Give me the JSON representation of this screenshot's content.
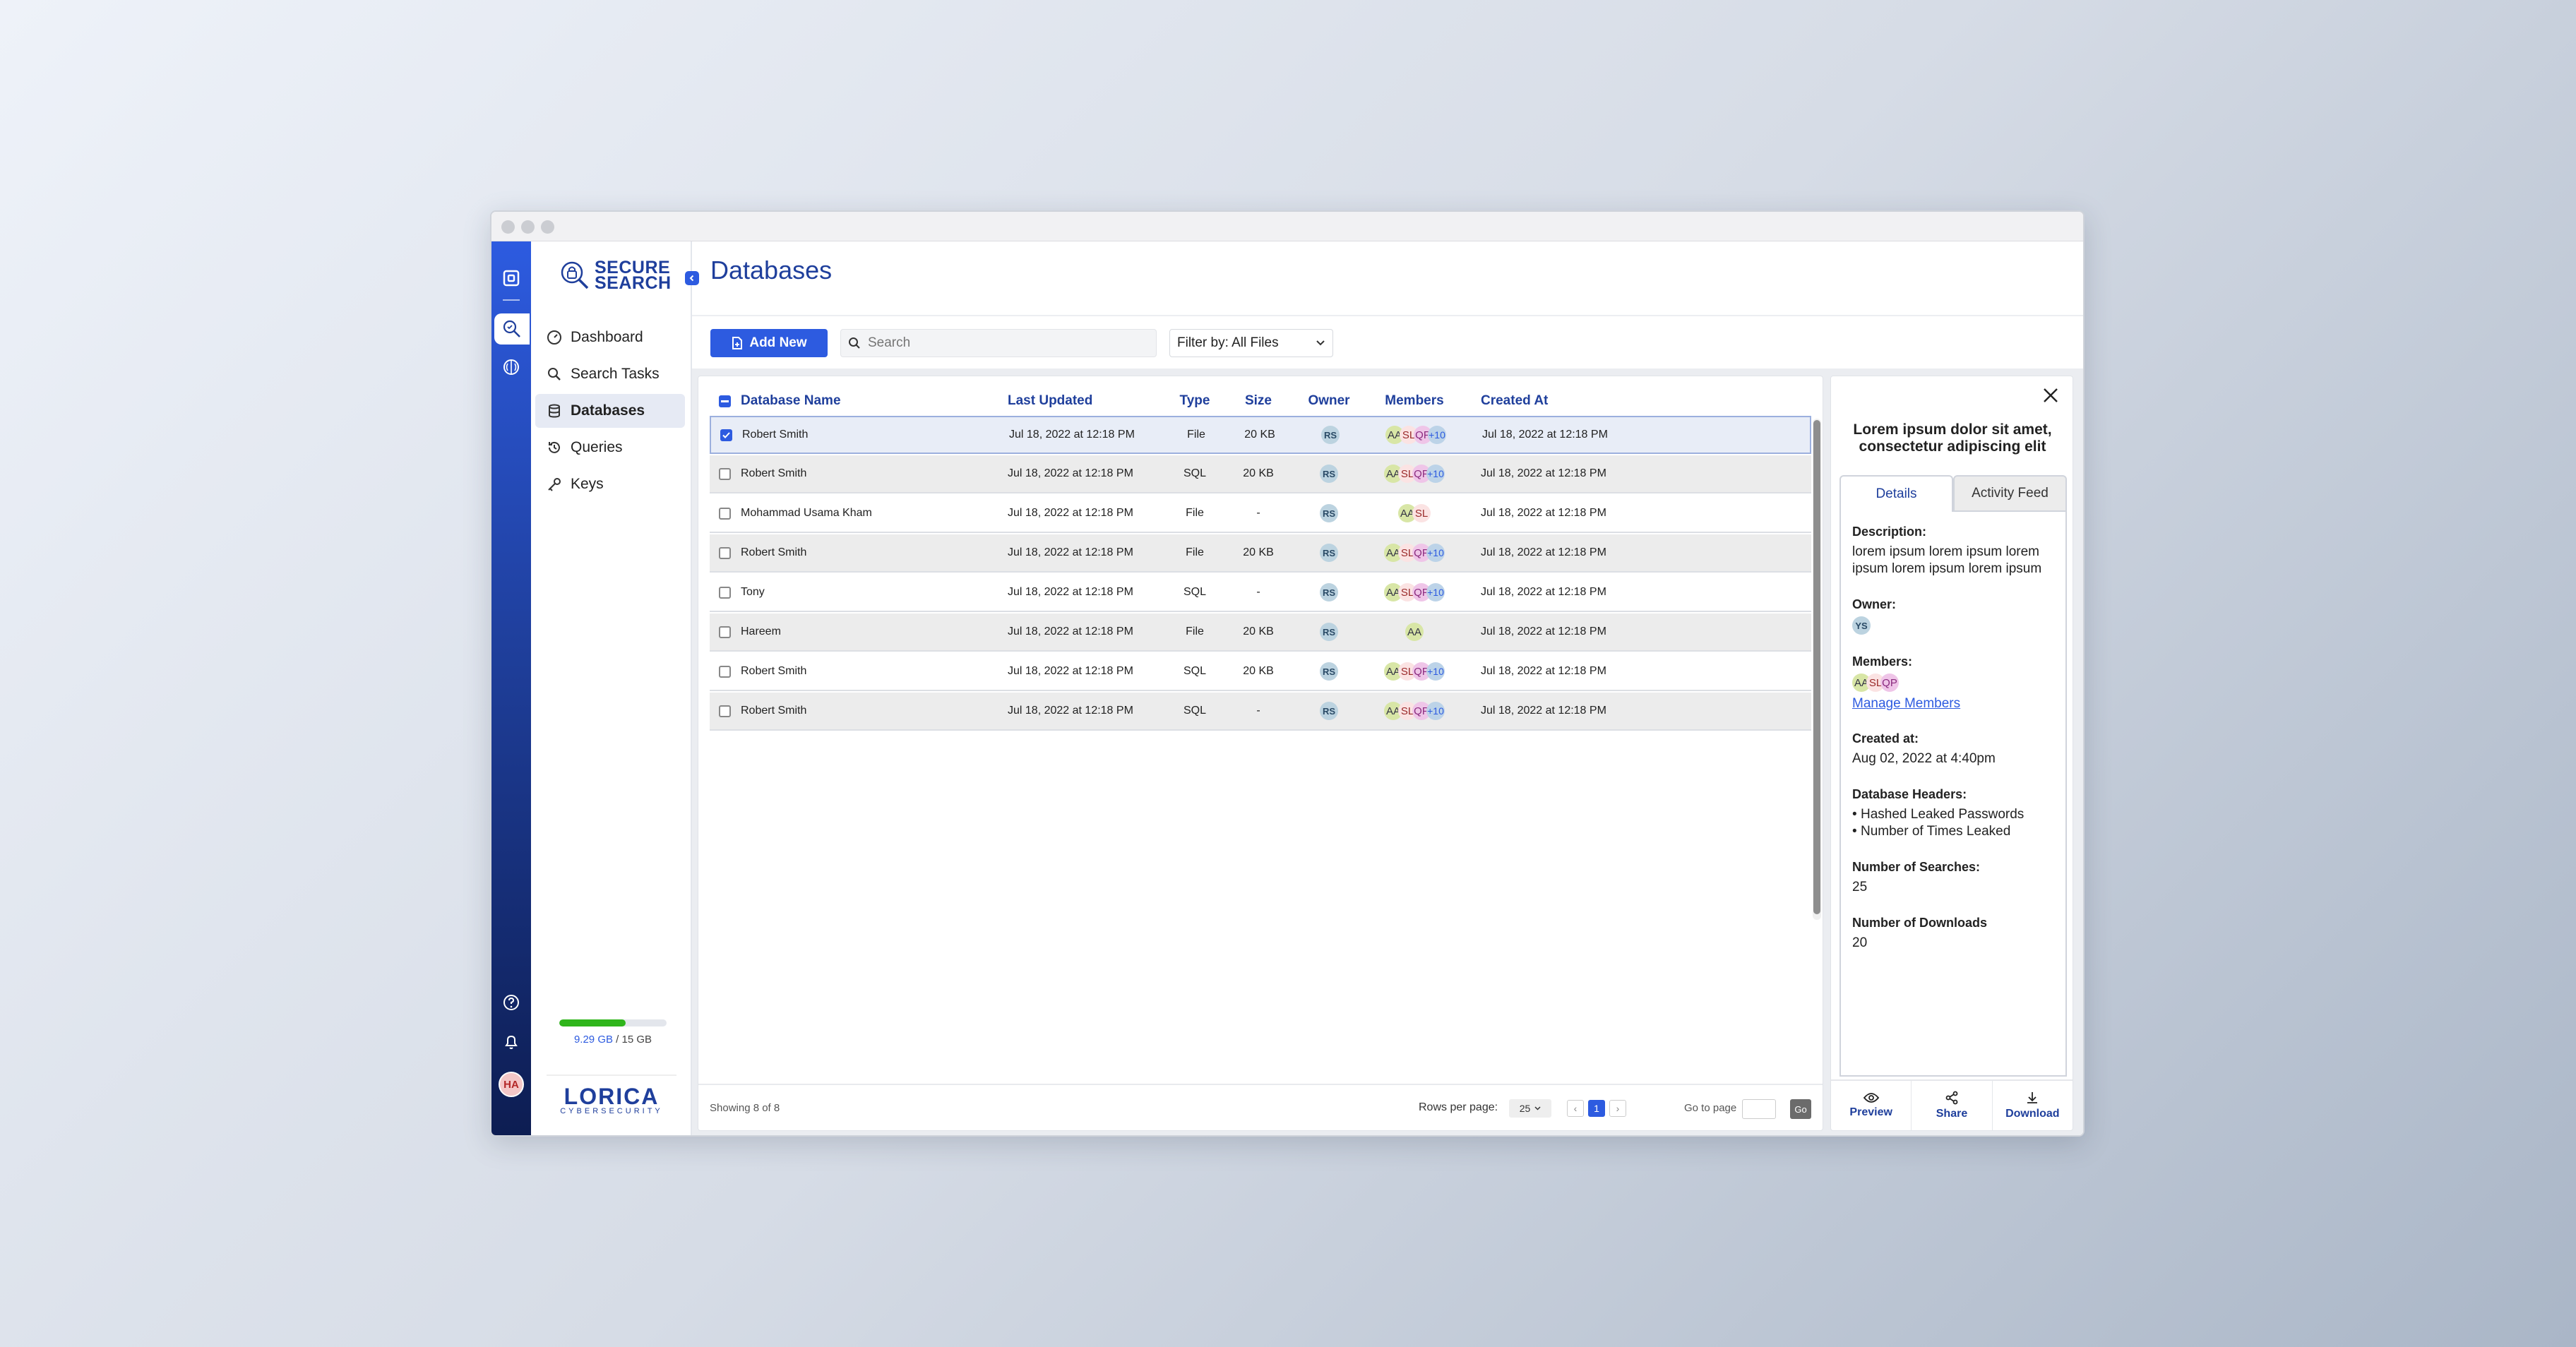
{
  "app": {
    "logo_line1": "SECURE",
    "logo_line2": "SEARCH",
    "brand_line1": "LORICA",
    "brand_line2": "CYBERSECURITY",
    "accent": "#2d5be0",
    "nav_dark": "#1f3f9c"
  },
  "rail": {
    "icons": [
      "home-icon",
      "search-shield-icon",
      "brain-icon"
    ],
    "bottom_icons": [
      "help-icon",
      "bell-icon"
    ],
    "user_initials": "HA"
  },
  "sidebar": {
    "items": [
      {
        "label": "Dashboard",
        "icon": "dashboard-icon"
      },
      {
        "label": "Search Tasks",
        "icon": "search-icon"
      },
      {
        "label": "Databases",
        "icon": "database-icon",
        "active": true
      },
      {
        "label": "Queries",
        "icon": "history-icon"
      },
      {
        "label": "Keys",
        "icon": "key-icon"
      }
    ],
    "storage": {
      "used": "9.29 GB",
      "total": "/ 15 GB",
      "fraction": 0.62
    }
  },
  "page": {
    "title": "Databases"
  },
  "toolbar": {
    "add_label": "Add New",
    "search_placeholder": "Search",
    "filter_label": "Filter by: All Files",
    "more_color": "#444444",
    "delete_color": "#a11616",
    "info_color": "#2d5be0"
  },
  "table": {
    "headers": {
      "name": "Database Name",
      "updated": "Last Updated",
      "type": "Type",
      "size": "Size",
      "owner": "Owner",
      "members": "Members",
      "created": "Created At"
    },
    "rows": [
      {
        "name": "Robert Smith",
        "updated": "Jul 18, 2022 at 12:18 PM",
        "type": "File",
        "size": "20 KB",
        "owner": "RS",
        "members": [
          "AA",
          "SL",
          "QP",
          "+10"
        ],
        "created": "Jul 18, 2022 at 12:18 PM",
        "checked": true
      },
      {
        "name": "Robert Smith",
        "updated": "Jul 18, 2022 at 12:18 PM",
        "type": "SQL",
        "size": "20 KB",
        "owner": "RS",
        "members": [
          "AA",
          "SL",
          "QP",
          "+10"
        ],
        "created": "Jul 18, 2022 at 12:18 PM",
        "checked": false
      },
      {
        "name": "Mohammad Usama Kham",
        "updated": "Jul 18, 2022 at 12:18 PM",
        "type": "File",
        "size": "-",
        "owner": "RS",
        "members": [
          "AA",
          "SL"
        ],
        "created": "Jul 18, 2022 at 12:18 PM",
        "checked": false
      },
      {
        "name": "Robert Smith",
        "updated": "Jul 18, 2022 at 12:18 PM",
        "type": "File",
        "size": "20 KB",
        "owner": "RS",
        "members": [
          "AA",
          "SL",
          "QP",
          "+10"
        ],
        "created": "Jul 18, 2022 at 12:18 PM",
        "checked": false
      },
      {
        "name": "Tony",
        "updated": "Jul 18, 2022 at 12:18 PM",
        "type": "SQL",
        "size": "-",
        "owner": "RS",
        "members": [
          "AA",
          "SL",
          "QP",
          "+10"
        ],
        "created": "Jul 18, 2022 at 12:18 PM",
        "checked": false
      },
      {
        "name": "Hareem",
        "updated": "Jul 18, 2022 at 12:18 PM",
        "type": "File",
        "size": "20 KB",
        "owner": "RS",
        "members": [
          "AA"
        ],
        "created": "Jul 18, 2022 at 12:18 PM",
        "checked": false
      },
      {
        "name": "Robert Smith",
        "updated": "Jul 18, 2022 at 12:18 PM",
        "type": "SQL",
        "size": "20 KB",
        "owner": "RS",
        "members": [
          "AA",
          "SL",
          "QP",
          "+10"
        ],
        "created": "Jul 18, 2022 at 12:18 PM",
        "checked": false
      },
      {
        "name": "Robert Smith",
        "updated": "Jul 18, 2022 at 12:18 PM",
        "type": "SQL",
        "size": "-",
        "owner": "RS",
        "members": [
          "AA",
          "SL",
          "QP",
          "+10"
        ],
        "created": "Jul 18, 2022 at 12:18 PM",
        "checked": false
      }
    ],
    "footer": {
      "showing": "Showing 8 of 8",
      "rows_label": "Rows per page:",
      "rows_value": "25",
      "current_page": "1",
      "goto_label": "Go to page",
      "go_label": "Go"
    }
  },
  "details": {
    "title": "Lorem ipsum dolor sit amet, consectetur adipiscing elit",
    "tabs": [
      "Details",
      "Activity Feed"
    ],
    "description_label": "Description:",
    "description": "lorem ipsum lorem ipsum lorem ipsum lorem ipsum lorem ipsum",
    "owner_label": "Owner:",
    "owner": "YS",
    "members_label": "Members:",
    "members": [
      "AA",
      "SL",
      "QP"
    ],
    "manage_label": "Manage Members",
    "created_label": "Created at:",
    "created": "Aug 02, 2022 at 4:40pm",
    "headers_label": "Database Headers:",
    "headers": [
      "Hashed Leaked Passwords",
      "Number of Times Leaked"
    ],
    "searches_label": "Number of Searches:",
    "searches": "25",
    "downloads_label": "Number of Downloads",
    "downloads": "20",
    "actions": [
      "Preview",
      "Share",
      "Download"
    ]
  }
}
